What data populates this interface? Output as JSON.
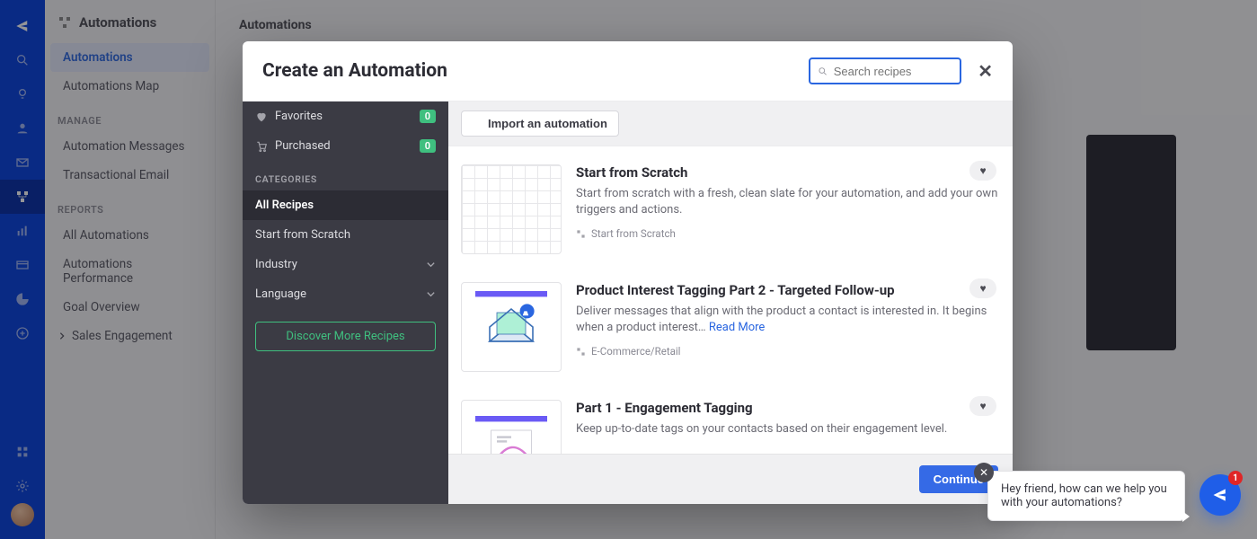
{
  "rail": {
    "icons": [
      "logo",
      "search",
      "bulb",
      "user",
      "mail",
      "automations",
      "reports",
      "table",
      "pie",
      "plus"
    ],
    "bottom": [
      "apps",
      "settings"
    ]
  },
  "sidebar": {
    "title": "Automations",
    "items": [
      {
        "label": "Automations",
        "active": true
      },
      {
        "label": "Automations Map"
      }
    ],
    "manage_heading": "MANAGE",
    "manage_items": [
      {
        "label": "Automation Messages"
      },
      {
        "label": "Transactional Email"
      }
    ],
    "reports_heading": "REPORTS",
    "reports_items": [
      {
        "label": "All Automations"
      },
      {
        "label": "Automations Performance"
      },
      {
        "label": "Goal Overview"
      },
      {
        "label": "Sales Engagement",
        "chevron": true
      }
    ]
  },
  "page": {
    "title": "Automations"
  },
  "modal": {
    "title": "Create an Automation",
    "search_placeholder": "Search recipes",
    "left": {
      "favorites": {
        "label": "Favorites",
        "count": "0"
      },
      "purchased": {
        "label": "Purchased",
        "count": "0"
      },
      "categories_heading": "CATEGORIES",
      "categories": [
        {
          "label": "All Recipes",
          "active": true
        },
        {
          "label": "Start from Scratch"
        },
        {
          "label": "Industry",
          "expandable": true
        },
        {
          "label": "Language",
          "expandable": true
        }
      ],
      "discover": "Discover More Recipes"
    },
    "import_label": "Import an automation",
    "recipes": [
      {
        "title": "Start from Scratch",
        "desc": "Start from scratch with a fresh, clean slate for your automation, and add your own triggers and actions.",
        "category": "Start from Scratch",
        "thumb": "grid"
      },
      {
        "title": "Product Interest Tagging Part 2 - Targeted Follow-up",
        "desc": "Deliver messages that align with the product a contact is interested in. It begins when a product interest… ",
        "read_more": "Read More",
        "category": "E-Commerce/Retail",
        "thumb": "envelope"
      },
      {
        "title": "Part 1 - Engagement Tagging",
        "desc": "Keep up-to-date tags on your contacts based on their engagement level.",
        "category": "",
        "thumb": "engage"
      }
    ],
    "continue": "Continue"
  },
  "chat": {
    "message": "Hey friend, how can we help you with your automations?",
    "badge": "1"
  }
}
